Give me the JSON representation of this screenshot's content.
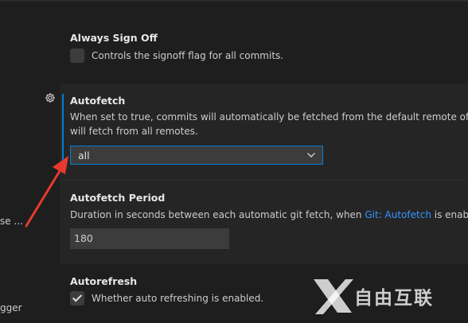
{
  "left_fragments": {
    "item_1": "se ...",
    "item_2": "gger"
  },
  "always_sign_off": {
    "title": "Always Sign Off",
    "description": "Controls the signoff flag for all commits.",
    "checked": false
  },
  "autofetch": {
    "title": "Autofetch",
    "description_line1": "When set to true, commits will automatically be fetched from the default remote of the",
    "description_line2": "will fetch from all remotes.",
    "selected_value": "all"
  },
  "autofetch_period": {
    "title": "Autofetch Period",
    "description_prefix": "Duration in seconds between each automatic git fetch, when ",
    "description_link": "Git: Autofetch",
    "description_suffix": " is enabled.",
    "value": "180"
  },
  "autorefresh": {
    "title": "Autorefresh",
    "description": "Whether auto refreshing is enabled.",
    "checked": true
  },
  "watermark": {
    "text": "自由互联"
  },
  "colors": {
    "background": "#1e1e1e",
    "panel": "#252526",
    "accent_blue": "#007fd4",
    "link": "#3794ff",
    "arrow": "#e8392f"
  },
  "icons": {
    "settings": "gear-icon",
    "dropdown": "chevron-down-icon"
  }
}
